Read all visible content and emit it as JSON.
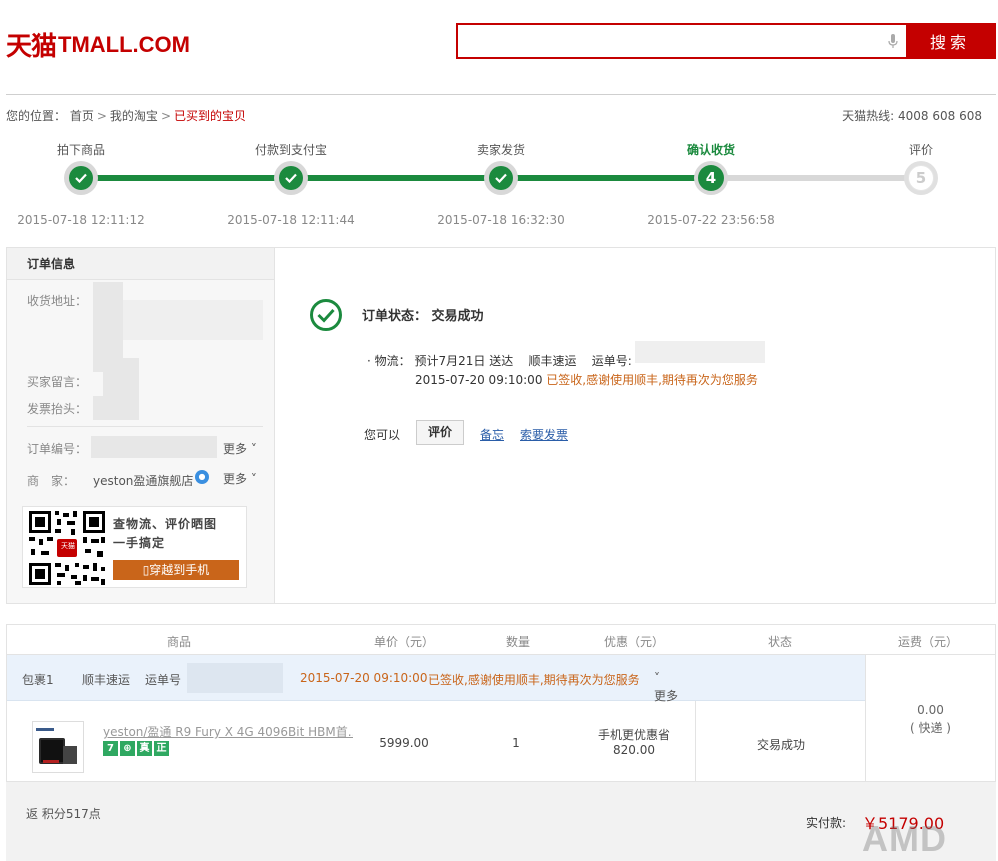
{
  "header": {
    "logo_cn": "天猫",
    "logo_en": "TMALL.COM",
    "search_placeholder": "",
    "search_button": "搜索"
  },
  "breadcrumb": {
    "prefix": "您的位置：",
    "items": [
      "首页",
      "我的淘宝",
      "已买到的宝贝"
    ]
  },
  "hotline": "天猫热线: 4008 608 608",
  "progress": {
    "steps": [
      {
        "label": "拍下商品",
        "time": "2015-07-18 12:11:12",
        "state": "done",
        "num": ""
      },
      {
        "label": "付款到支付宝",
        "time": "2015-07-18 12:11:44",
        "state": "done",
        "num": ""
      },
      {
        "label": "卖家发货",
        "time": "2015-07-18 16:32:30",
        "state": "done",
        "num": ""
      },
      {
        "label": "确认收货",
        "time": "2015-07-22 23:56:58",
        "state": "current",
        "num": "4"
      },
      {
        "label": "评价",
        "time": "",
        "state": "todo",
        "num": "5"
      }
    ]
  },
  "order_info": {
    "title": "订单信息",
    "address_label": "收货地址：",
    "message_label": "买家留言：",
    "invoice_label": "发票抬头：",
    "order_no_label": "订单编号：",
    "more1": "更多",
    "seller_label": "商　家：",
    "seller_name": "yeston盈通旗舰店",
    "more2": "更多",
    "qr_line1": "查物流、评价晒图",
    "qr_line2": "一手搞定",
    "qr_button": "穿越到手机",
    "qr_badge": "天猫"
  },
  "status": {
    "text": "订单状态：  交易成功",
    "logistics_prefix": "· 物流：",
    "eta": "预计7月21日 送达",
    "carrier": "顺丰速运",
    "waybill_label": "运单号:",
    "last_update_time": "2015-07-20 09:10:00",
    "last_update_msg": "已签收,感谢使用顺丰,期待再次为您服务",
    "you_can": "您可以",
    "review_button": "评价",
    "memo_link": "备忘",
    "invoice_link": "索要发票"
  },
  "items_table": {
    "headers": [
      "商品",
      "单价（元）",
      "数量",
      "优惠（元）",
      "状态",
      "运费（元）"
    ],
    "package": {
      "name": "包裹1",
      "carrier": "顺丰速运",
      "waybill_label": "运单号",
      "time": "2015-07-20 09:10:00",
      "msg": "已签收,感谢使用顺丰,期待再次为您服务",
      "more": "更多"
    },
    "item": {
      "title": "yeston/盈通 R9 Fury X 4G 4096Bit HBM首...",
      "badges": [
        "7",
        "⊕",
        "真",
        "正"
      ],
      "price": "5999.00",
      "qty": "1",
      "discount_label": "手机更优惠省",
      "discount_value": "820.00",
      "status": "交易成功"
    },
    "freight": {
      "value": "0.00",
      "type": "( 快递 )"
    }
  },
  "footer": {
    "points": "返 积分517点",
    "paid_label": "实付款:",
    "paid_amount": "￥5179.00"
  },
  "watermark": "AMD"
}
